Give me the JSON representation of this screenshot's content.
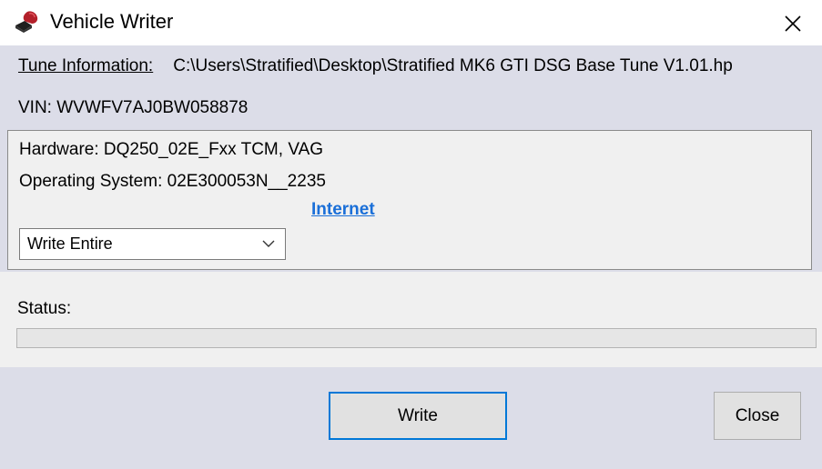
{
  "window": {
    "title": "Vehicle Writer",
    "icon": "gear-shift-knob-icon",
    "close_icon": "close-icon"
  },
  "tune": {
    "label": "Tune Information:",
    "path": "C:\\Users\\Stratified\\Desktop\\Stratified MK6 GTI DSG Base Tune V1.01.hp"
  },
  "vin": "VIN: WVWFV7AJ0BW058878",
  "hardware": "Hardware: DQ250_02E_Fxx TCM, VAG",
  "operating_system": "Operating System: 02E300053N__2235",
  "internet_link": "Internet",
  "write_mode": {
    "selected": "Write Entire"
  },
  "status": {
    "label": "Status:",
    "progress": 0
  },
  "buttons": {
    "write": "Write",
    "close": "Close"
  },
  "colors": {
    "panel_background": "#dcdde8",
    "link": "#1a6fd8",
    "focus_border": "#0078d7"
  }
}
